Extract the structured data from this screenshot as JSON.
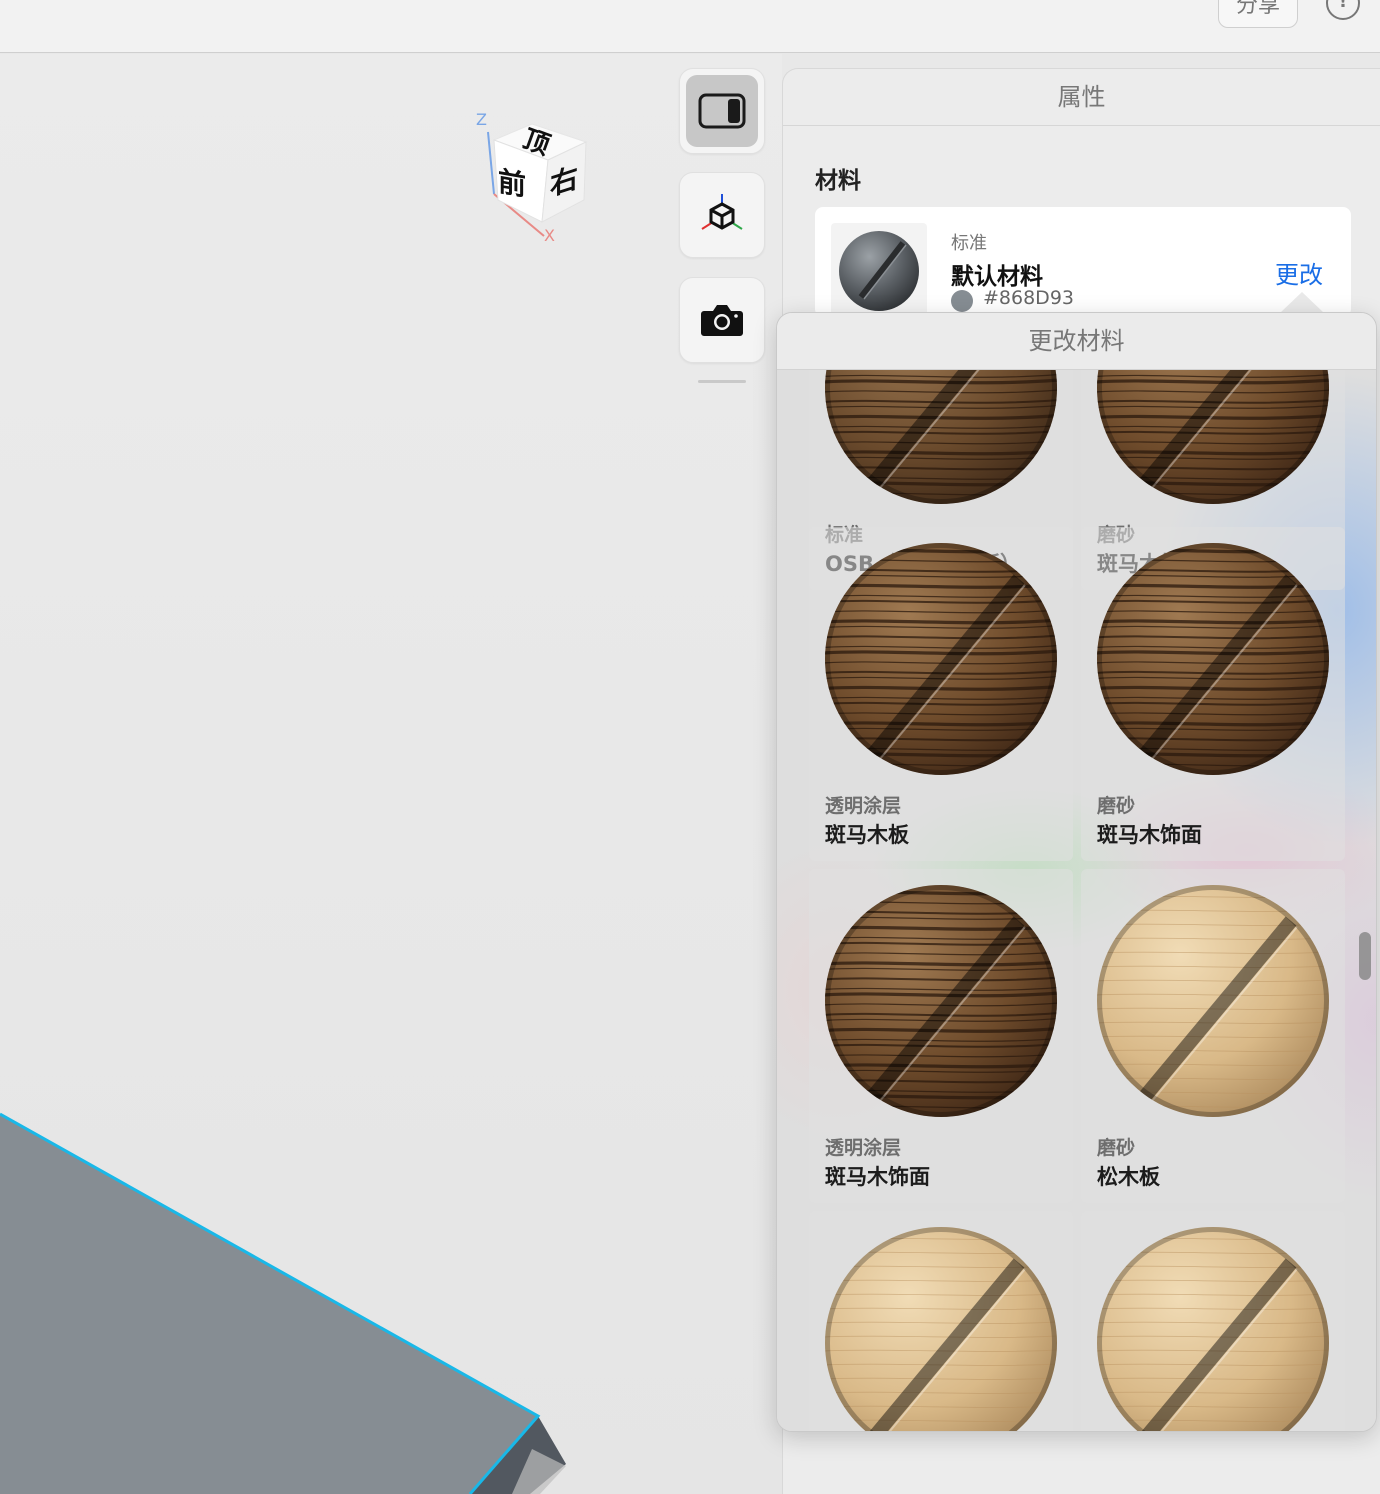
{
  "toolbar": {
    "share_label": "分享",
    "info_icon": "info-icon"
  },
  "viewcube": {
    "top": "顶",
    "front": "前",
    "right": "右",
    "axis_z": "Z",
    "axis_x": "X"
  },
  "tools": [
    {
      "name": "inspector-toggle",
      "icon": "sidebar-icon",
      "active": true
    },
    {
      "name": "transform",
      "icon": "axes-cube-icon",
      "active": false
    },
    {
      "name": "snapshot",
      "icon": "camera-icon",
      "active": false
    }
  ],
  "properties": {
    "title": "属性",
    "section_title": "材料",
    "material": {
      "kind": "标准",
      "name": "默认材料",
      "color_hex": "#868D93",
      "swatch_color": "#868D93",
      "change_label": "更改"
    }
  },
  "popover": {
    "title": "更改材料",
    "tiles": [
      {
        "kind": "标准",
        "name": "OSB（定向刨花板）",
        "texture": "osb"
      },
      {
        "kind": "磨砂",
        "name": "斑马木板",
        "texture": "zebra"
      },
      {
        "kind": "透明涂层",
        "name": "斑马木板",
        "texture": "zebra"
      },
      {
        "kind": "磨砂",
        "name": "斑马木饰面",
        "texture": "zebra"
      },
      {
        "kind": "透明涂层",
        "name": "斑马木饰面",
        "texture": "zebra"
      },
      {
        "kind": "磨砂",
        "name": "松木板",
        "texture": "pine"
      },
      {
        "kind": "",
        "name": "",
        "texture": "pine"
      },
      {
        "kind": "",
        "name": "",
        "texture": "pine"
      }
    ]
  },
  "colors": {
    "accent": "#1a6ee6",
    "selection_edge": "#19b8e8",
    "object_gray": "#868D93"
  }
}
